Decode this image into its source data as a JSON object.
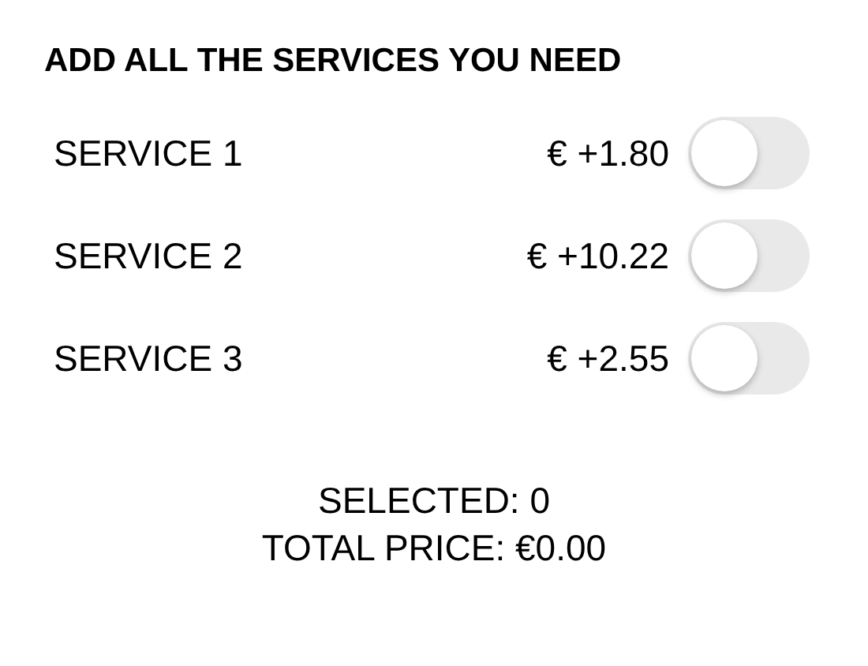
{
  "title": "ADD ALL THE SERVICES YOU NEED",
  "services": [
    {
      "name": "SERVICE 1",
      "price": "€ +1.80",
      "on": false
    },
    {
      "name": "SERVICE 2",
      "price": "€ +10.22",
      "on": false
    },
    {
      "name": "SERVICE 3",
      "price": "€ +2.55",
      "on": false
    }
  ],
  "summary": {
    "selected": "SELECTED: 0",
    "total": "TOTAL PRICE: €0.00"
  }
}
